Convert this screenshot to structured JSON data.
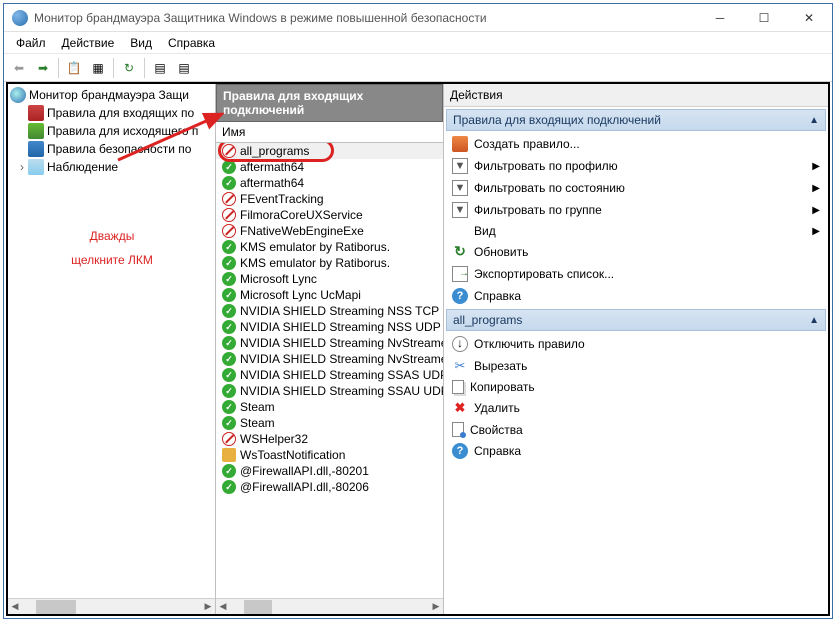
{
  "window_title": "Монитор брандмауэра Защитника Windows в режиме повышенной безопасности",
  "menu": {
    "file": "Файл",
    "action": "Действие",
    "view": "Вид",
    "help": "Справка"
  },
  "tree": {
    "root": "Монитор брандмауэра Защи",
    "inbound": "Правила для входящих по",
    "outbound": "Правила для исходящего п",
    "consec": "Правила безопасности по",
    "monitoring": "Наблюдение"
  },
  "mid": {
    "header": "Правила для входящих подключений",
    "col_name": "Имя",
    "rules": [
      {
        "name": "all_programs",
        "type": "block",
        "hl": true,
        "selected": true
      },
      {
        "name": "aftermath64",
        "type": "allow"
      },
      {
        "name": "aftermath64",
        "type": "allow"
      },
      {
        "name": "FEventTracking",
        "type": "block"
      },
      {
        "name": "FilmoraCoreUXService",
        "type": "block"
      },
      {
        "name": "FNativeWebEngineExe",
        "type": "block"
      },
      {
        "name": "KMS emulator by Ratiborus.",
        "type": "allow"
      },
      {
        "name": "KMS emulator by Ratiborus.",
        "type": "allow"
      },
      {
        "name": "Microsoft Lync",
        "type": "allow"
      },
      {
        "name": "Microsoft Lync UcMapi",
        "type": "allow"
      },
      {
        "name": "NVIDIA SHIELD Streaming NSS TCP Excep",
        "type": "allow"
      },
      {
        "name": "NVIDIA SHIELD Streaming NSS UDP Exce",
        "type": "allow"
      },
      {
        "name": "NVIDIA SHIELD Streaming NvStreamer TC",
        "type": "allow"
      },
      {
        "name": "NVIDIA SHIELD Streaming NvStreamer U",
        "type": "allow"
      },
      {
        "name": "NVIDIA SHIELD Streaming SSAS UDP Exc",
        "type": "allow"
      },
      {
        "name": "NVIDIA SHIELD Streaming SSAU UDP Exc",
        "type": "allow"
      },
      {
        "name": "Steam",
        "type": "allow"
      },
      {
        "name": "Steam",
        "type": "allow"
      },
      {
        "name": "WSHelper32",
        "type": "block"
      },
      {
        "name": "WsToastNotification",
        "type": "lock"
      },
      {
        "name": "@FirewallAPI.dll,-80201",
        "type": "allow"
      },
      {
        "name": "@FirewallAPI.dll,-80206",
        "type": "allow"
      }
    ]
  },
  "actions": {
    "header": "Действия",
    "sect1": "Правила для входящих подключений",
    "new_rule": "Создать правило...",
    "filter_profile": "Фильтровать по профилю",
    "filter_state": "Фильтровать по состоянию",
    "filter_group": "Фильтровать по группе",
    "view": "Вид",
    "refresh": "Обновить",
    "export": "Экспортировать список...",
    "help": "Справка",
    "sect2": "all_programs",
    "disable": "Отключить правило",
    "cut": "Вырезать",
    "copy": "Копировать",
    "delete": "Удалить",
    "props": "Свойства",
    "help2": "Справка"
  },
  "annotation": {
    "line1": "Дважды",
    "line2": "щелкните ЛКМ"
  }
}
